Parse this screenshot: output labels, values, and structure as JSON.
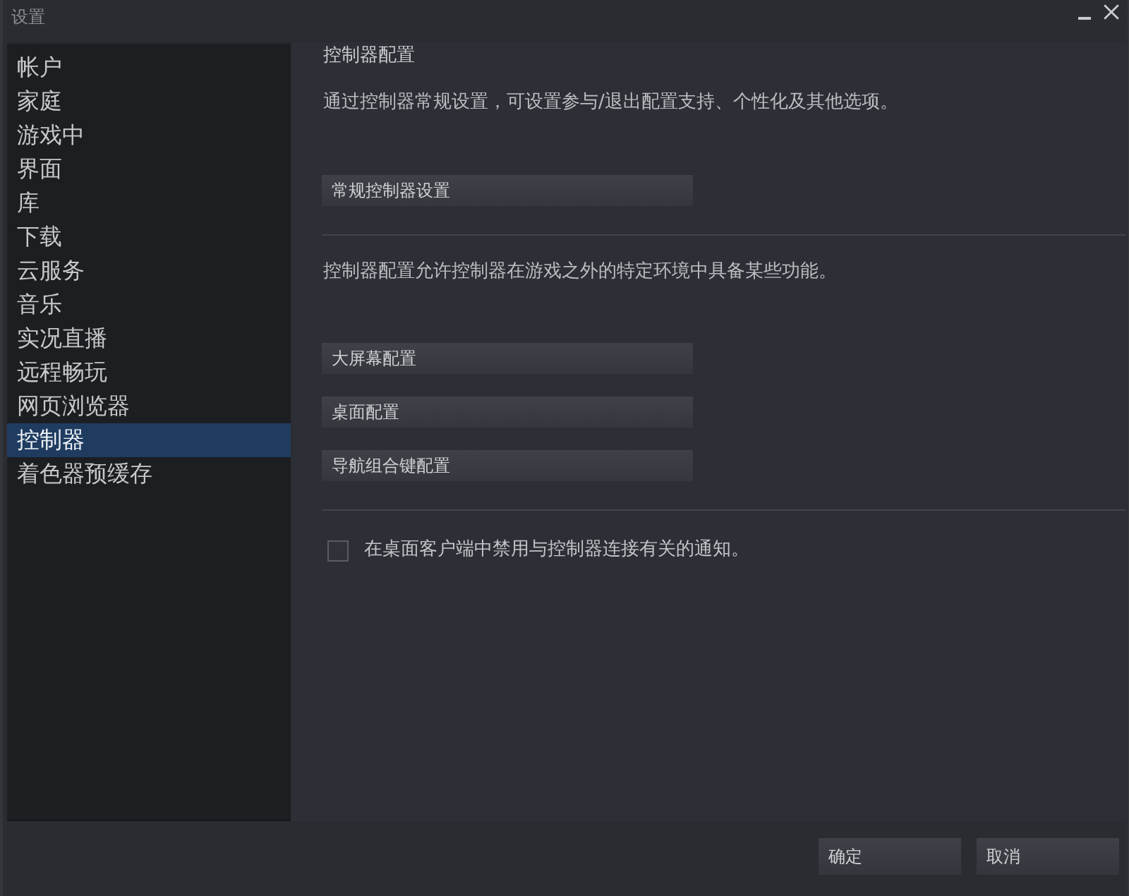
{
  "window": {
    "title": "设置"
  },
  "sidebar": {
    "items": [
      {
        "label": "帐户",
        "selected": false
      },
      {
        "label": "家庭",
        "selected": false
      },
      {
        "label": "游戏中",
        "selected": false
      },
      {
        "label": "界面",
        "selected": false
      },
      {
        "label": "库",
        "selected": false
      },
      {
        "label": "下载",
        "selected": false
      },
      {
        "label": "云服务",
        "selected": false
      },
      {
        "label": "音乐",
        "selected": false
      },
      {
        "label": "实况直播",
        "selected": false
      },
      {
        "label": "远程畅玩",
        "selected": false
      },
      {
        "label": "网页浏览器",
        "selected": false
      },
      {
        "label": "控制器",
        "selected": true
      },
      {
        "label": "着色器预缓存",
        "selected": false
      }
    ]
  },
  "panel": {
    "title": "控制器配置",
    "sections": [
      {
        "description": "通过控制器常规设置，可设置参与/退出配置支持、个性化及其他选项。",
        "buttons": [
          "常规控制器设置"
        ]
      },
      {
        "description": "控制器配置允许控制器在游戏之外的特定环境中具备某些功能。",
        "buttons": [
          "大屏幕配置",
          "桌面配置",
          "导航组合键配置"
        ]
      }
    ],
    "checkbox": {
      "label": "在桌面客户端中禁用与控制器连接有关的通知。",
      "checked": false
    }
  },
  "footer": {
    "buttons": [
      "确定",
      "取消"
    ]
  }
}
